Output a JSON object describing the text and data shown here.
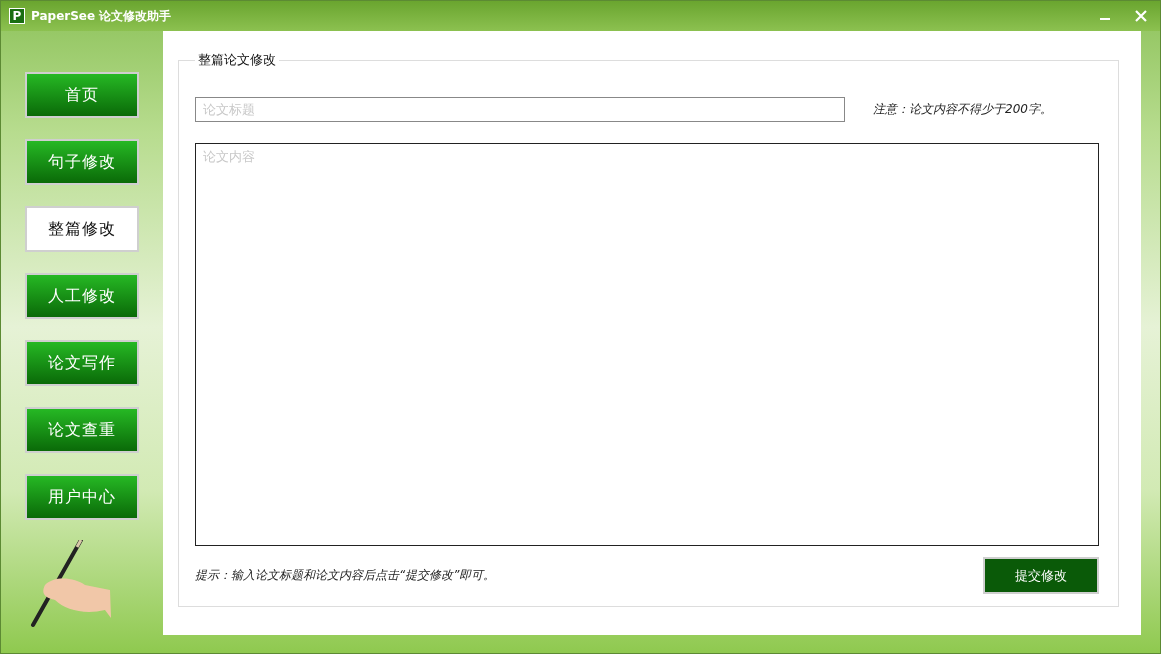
{
  "window": {
    "title": "PaperSee 论文修改助手",
    "logo": "P"
  },
  "nav": [
    {
      "label": "首页",
      "selected": false
    },
    {
      "label": "句子修改",
      "selected": false
    },
    {
      "label": "整篇修改",
      "selected": true
    },
    {
      "label": "人工修改",
      "selected": false
    },
    {
      "label": "论文写作",
      "selected": false
    },
    {
      "label": "论文查重",
      "selected": false
    },
    {
      "label": "用户中心",
      "selected": false
    }
  ],
  "form": {
    "legend": "整篇论文修改",
    "title_field": {
      "placeholder": "论文标题"
    },
    "note": "注意：论文内容不得少于200字。",
    "content_field": {
      "placeholder": "论文内容"
    },
    "hint": "提示：输入论文标题和论文内容后点击“提交修改”即可。",
    "submit": "提交修改"
  }
}
